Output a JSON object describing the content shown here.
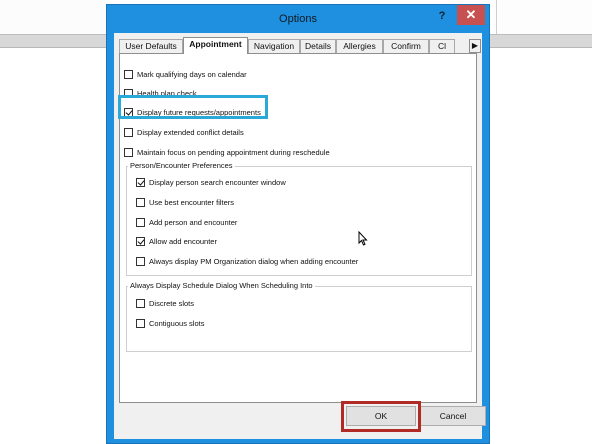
{
  "dialog": {
    "title": "Options",
    "help_glyph": "?",
    "close_glyph": "✕"
  },
  "tabs": [
    {
      "label": "User Defaults"
    },
    {
      "label": "Appointment"
    },
    {
      "label": "Navigation"
    },
    {
      "label": "Details"
    },
    {
      "label": "Allergies"
    },
    {
      "label": "Confirm"
    },
    {
      "label": "Cl"
    }
  ],
  "tab_scroll_glyph": "▶",
  "options": {
    "mark_qualifying_days": {
      "label": "Mark qualifying days on calendar",
      "checked": false
    },
    "health_plan_check": {
      "label": "Health plan check",
      "checked": false
    },
    "display_future_requests": {
      "label": "Display future requests/appointments",
      "checked": true
    },
    "display_extended_conflict": {
      "label": "Display extended conflict details",
      "checked": false
    },
    "maintain_focus": {
      "label": "Maintain focus on pending appointment during reschedule",
      "checked": false
    }
  },
  "person_group": {
    "label": "Person/Encounter Preferences",
    "options": [
      {
        "label": "Display person search encounter window",
        "checked": true
      },
      {
        "label": "Use best encounter filters",
        "checked": false
      },
      {
        "label": "Add person and encounter",
        "checked": false
      },
      {
        "label": "Allow add encounter",
        "checked": true
      },
      {
        "label": "Always display PM Organization dialog when adding encounter",
        "checked": false
      }
    ]
  },
  "schedule_group": {
    "label": "Always Display Schedule Dialog When Scheduling Into",
    "options": [
      {
        "label": "Discrete slots",
        "checked": false
      },
      {
        "label": "Contiguous slots",
        "checked": false
      }
    ]
  },
  "buttons": {
    "ok": "OK",
    "cancel": "Cancel"
  },
  "colors": {
    "window_frame": "#1e90df",
    "highlight_checkbox": "#2aa8d8",
    "highlight_ok": "#b22a25",
    "close_button": "#c75050"
  }
}
